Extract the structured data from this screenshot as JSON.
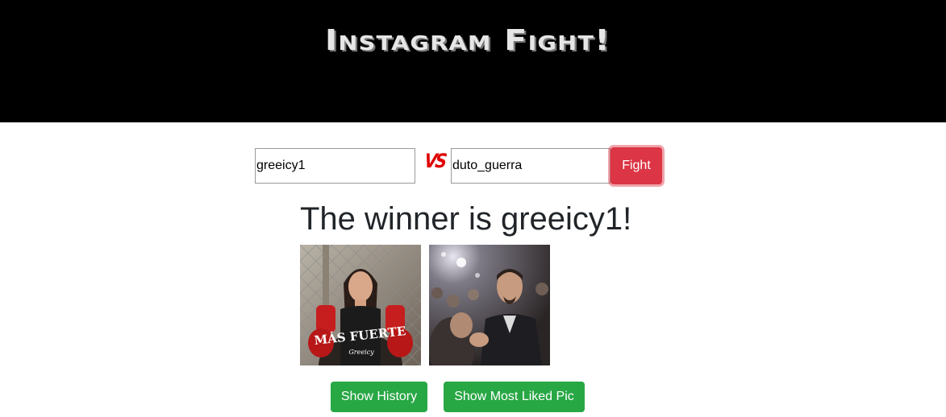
{
  "header": {
    "title": "Instagram Fight!"
  },
  "form": {
    "player1_value": "greeicy1",
    "vs_label": "VS",
    "player2_value": "duto_guerra",
    "fight_label": "Fight"
  },
  "result": {
    "winner_text": "The winner is greeicy1!",
    "images": [
      {
        "alt": "greeicy1 profile photo",
        "overlay_text": "MÁS FUERTE",
        "signature": "Greeicy"
      },
      {
        "alt": "duto_guerra profile photo"
      }
    ]
  },
  "actions": {
    "history_label": "Show History",
    "liked_label": "Show Most Liked Pic"
  },
  "colors": {
    "header_bg": "#000000",
    "vs": "#e00000",
    "fight_button": "#dc3545",
    "action_buttons": "#28a745"
  }
}
